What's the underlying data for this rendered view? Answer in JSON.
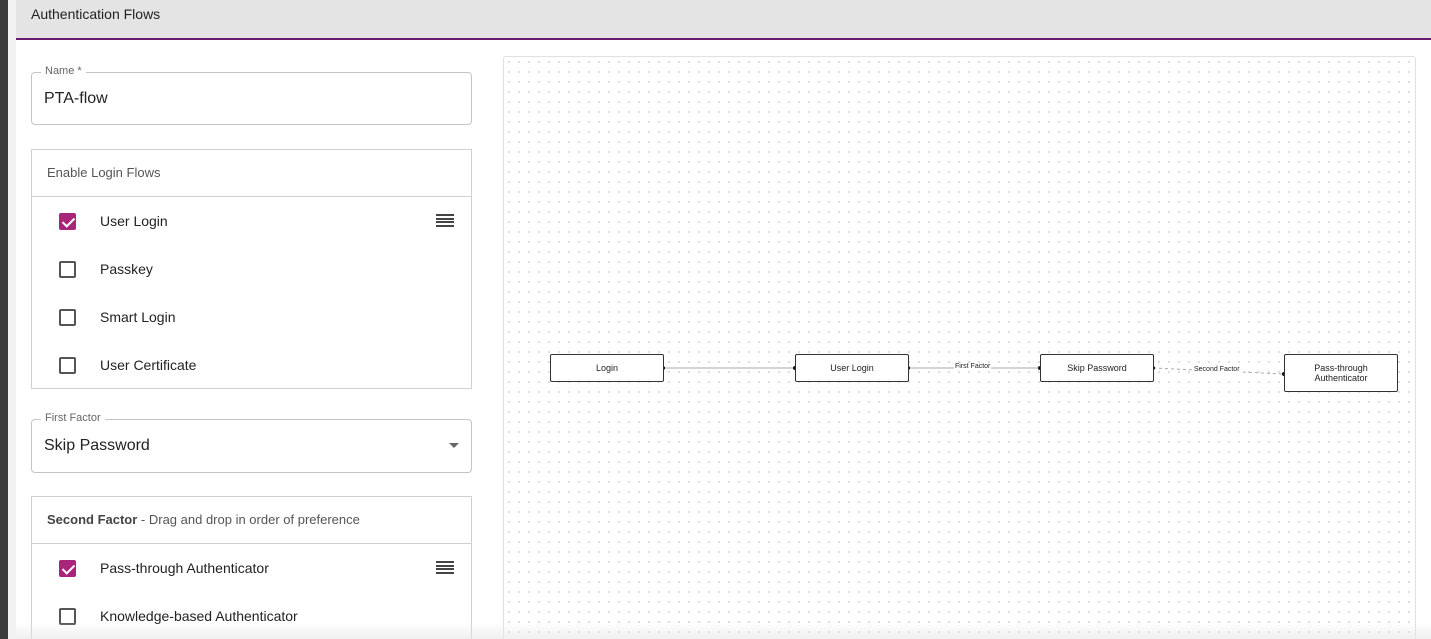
{
  "header": {
    "title": "Authentication Flows"
  },
  "name_field": {
    "label": "Name *",
    "value": "PTA-flow"
  },
  "login_flows": {
    "title": "Enable Login Flows",
    "items": [
      {
        "label": "User Login",
        "checked": true
      },
      {
        "label": "Passkey",
        "checked": false
      },
      {
        "label": "Smart Login",
        "checked": false
      },
      {
        "label": "User Certificate",
        "checked": false
      }
    ]
  },
  "first_factor": {
    "label": "First Factor",
    "value": "Skip Password"
  },
  "second_factor": {
    "title_bold": "Second Factor",
    "title_rest": " - Drag and drop in order of preference",
    "items": [
      {
        "label": "Pass-through Authenticator",
        "checked": true
      },
      {
        "label": "Knowledge-based Authenticator",
        "checked": false
      }
    ]
  },
  "diagram": {
    "nodes": [
      {
        "label": "Login"
      },
      {
        "label": "User Login"
      },
      {
        "label": "Skip Password"
      },
      {
        "label": "Pass-through Authenticator"
      }
    ],
    "edges": [
      {
        "label": ""
      },
      {
        "label": "First Factor"
      },
      {
        "label": "Second Factor"
      }
    ]
  },
  "colors": {
    "accent": "#a8267a",
    "header_rule": "#6a1b6e"
  },
  "icons": {
    "drag": "drag-handle-icon",
    "dropdown": "chevron-down-icon"
  }
}
